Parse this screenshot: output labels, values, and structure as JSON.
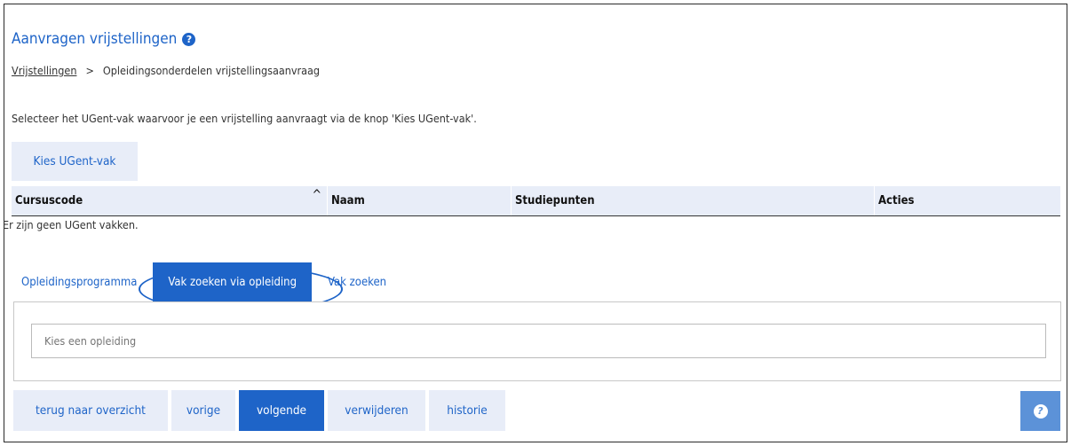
{
  "header": {
    "title": "Aanvragen vrijstellingen",
    "help_icon": "?"
  },
  "breadcrumb": {
    "items": [
      "Vrijstellingen",
      "Opleidingsonderdelen vrijstellingsaanvraag"
    ],
    "separator": ">"
  },
  "instruction": "Selecteer het UGent-vak waarvoor je een vrijstelling aanvraagt via de knop 'Kies UGent-vak'.",
  "kies_button": "Kies UGent-vak",
  "table": {
    "columns": [
      "Cursuscode",
      "Naam",
      "Studiepunten",
      "Acties"
    ],
    "sort_indicator": "^",
    "empty_message": "Er zijn geen UGent vakken."
  },
  "tabs": [
    {
      "label": "Opleidingsprogramma",
      "active": false
    },
    {
      "label": "Vak zoeken via opleiding",
      "active": true
    },
    {
      "label": "Vak zoeken",
      "active": false
    }
  ],
  "opleiding_select": {
    "placeholder": "Kies een opleiding"
  },
  "footer": {
    "buttons": [
      "terug naar overzicht",
      "vorige",
      "volgende",
      "verwijderen",
      "historie"
    ],
    "help_icon": "?"
  },
  "colors": {
    "accent": "#1e64c8",
    "light": "#e8edf8",
    "help": "#5c92d8"
  }
}
